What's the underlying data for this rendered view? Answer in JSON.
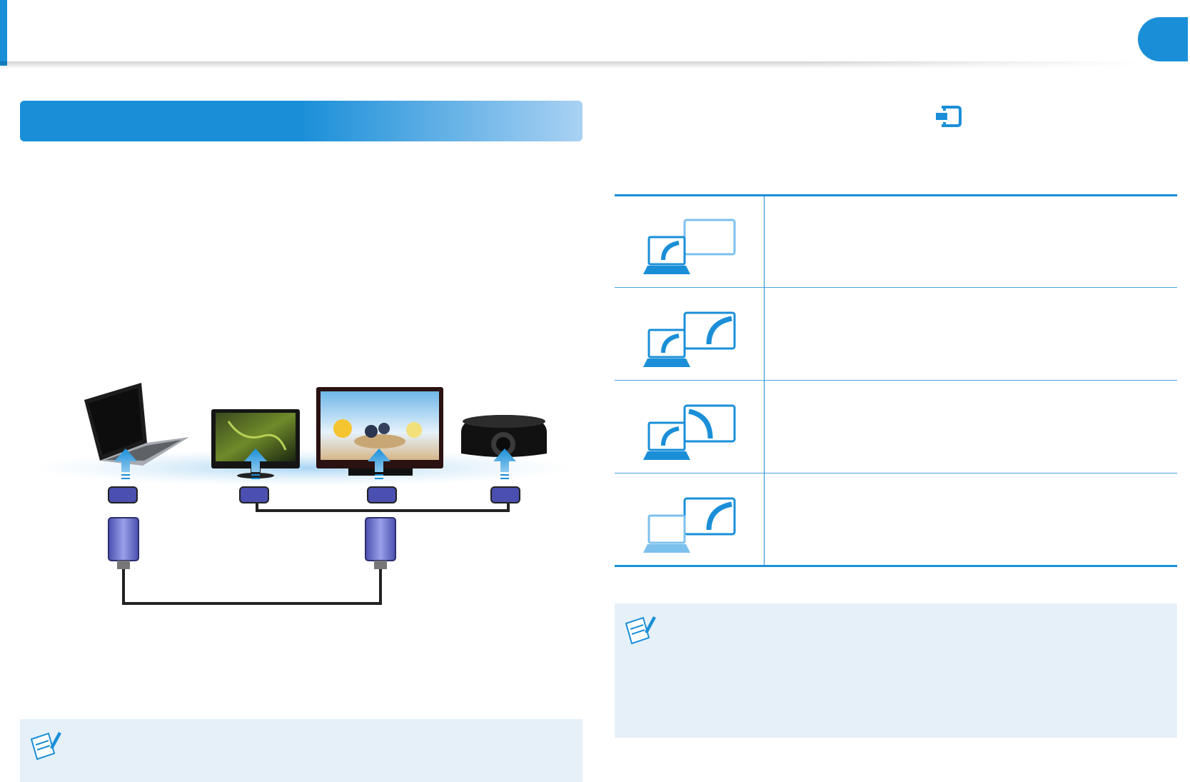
{
  "header": {
    "accent_color": "#1a8fd8",
    "chapter_marker_color": "#1a8fd8"
  },
  "left_section": {
    "bar_gradient": [
      "#1a8fd8",
      "#a9d1f3"
    ],
    "diagram": {
      "devices": [
        "laptop",
        "monitor",
        "tv",
        "projector"
      ],
      "connector": "vga-connector-icon",
      "cable": "vga-cable"
    },
    "note_icon": "note-pencil-icon"
  },
  "right_section": {
    "hotkey_icon": "display-switch-icon",
    "table": {
      "rows": [
        {
          "icon": "pc-screen-only-icon"
        },
        {
          "icon": "duplicate-icon"
        },
        {
          "icon": "extend-icon"
        },
        {
          "icon": "second-screen-only-icon"
        }
      ]
    },
    "note_icon": "note-pencil-icon"
  },
  "colors": {
    "primary": "#1a8fd8",
    "light": "#7cc1ee",
    "note_bg": "#e6f0f9"
  }
}
